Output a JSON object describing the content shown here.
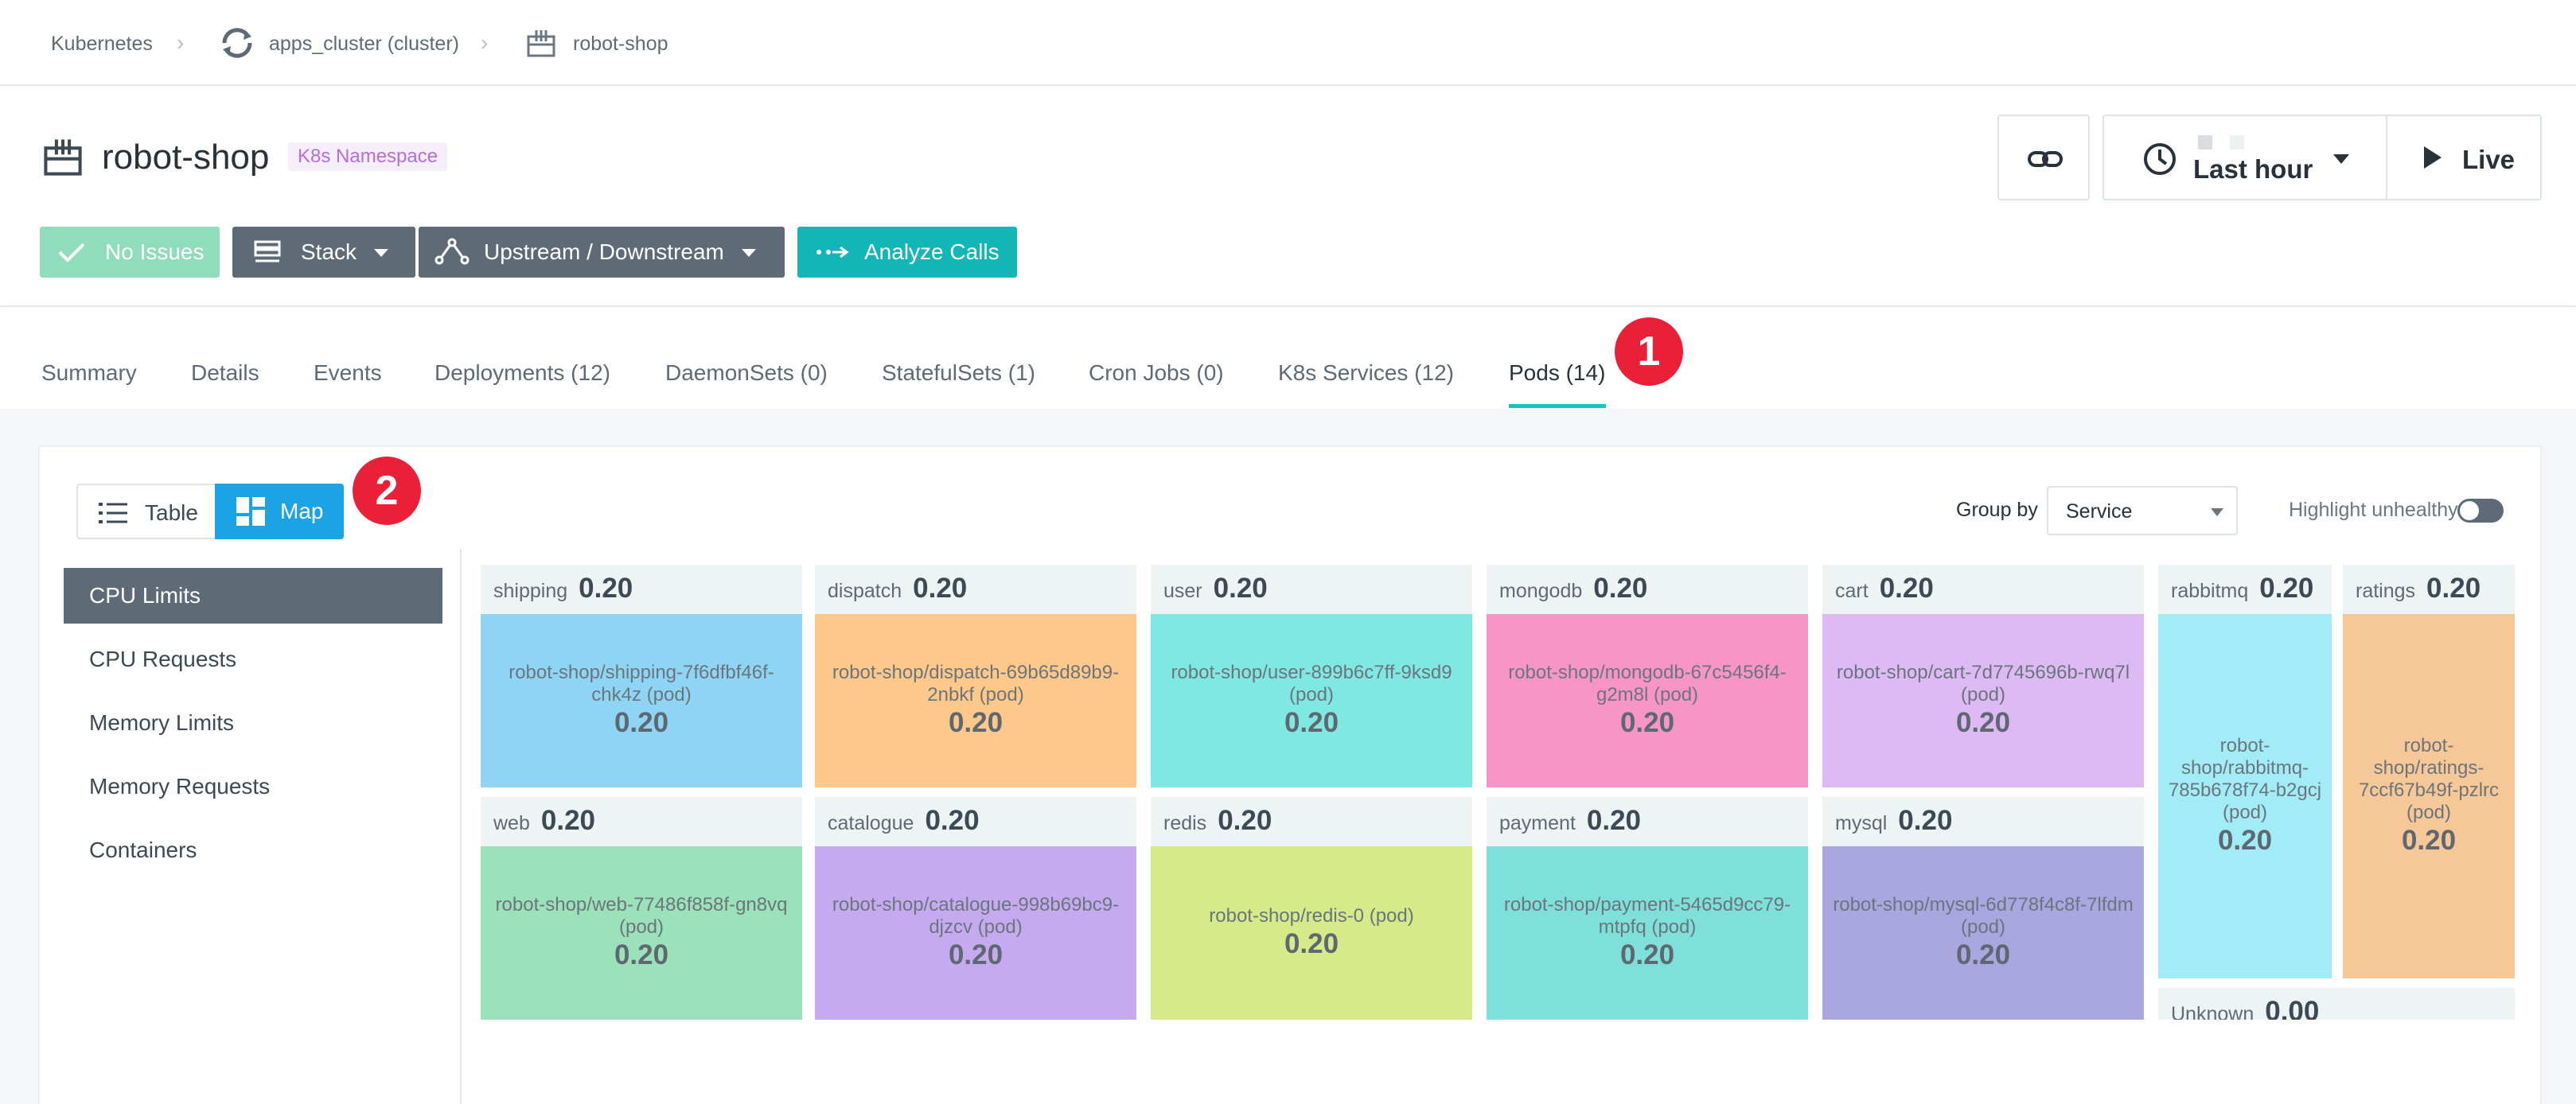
{
  "breadcrumb": {
    "root": "Kubernetes",
    "cluster": "apps_cluster (cluster)",
    "namespace": "robot-shop"
  },
  "header": {
    "title": "robot-shop",
    "badge": "K8s Namespace",
    "time_range": "Last hour",
    "live_label": "Live"
  },
  "actions": {
    "no_issues": "No Issues",
    "stack": "Stack",
    "upstream": "Upstream / Downstream",
    "analyze": "Analyze Calls"
  },
  "tabs": [
    {
      "label": "Summary"
    },
    {
      "label": "Details"
    },
    {
      "label": "Events"
    },
    {
      "label": "Deployments (12)"
    },
    {
      "label": "DaemonSets (0)"
    },
    {
      "label": "StatefulSets (1)"
    },
    {
      "label": "Cron Jobs (0)"
    },
    {
      "label": "K8s Services (12)"
    },
    {
      "label": "Pods (14)"
    }
  ],
  "annotations": {
    "step1": "1",
    "step2": "2"
  },
  "view_toggle": {
    "table": "Table",
    "map": "Map",
    "selected": "Map"
  },
  "group_by": {
    "label": "Group by",
    "value": "Service"
  },
  "highlight": {
    "label": "Highlight unhealthy",
    "enabled": false
  },
  "metrics": [
    "CPU Limits",
    "CPU Requests",
    "Memory Limits",
    "Memory Requests",
    "Containers"
  ],
  "selected_metric": "CPU Limits",
  "groups": [
    {
      "name": "shipping",
      "value": "0.20",
      "pod_name": "robot-shop/shipping-7f6dfbf46f-chk4z (pod)",
      "pod_value": "0.20",
      "color": "#8ed4f5"
    },
    {
      "name": "dispatch",
      "value": "0.20",
      "pod_name": "robot-shop/dispatch-69b65d89b9-2nbkf (pod)",
      "pod_value": "0.20",
      "color": "#fdc88a"
    },
    {
      "name": "user",
      "value": "0.20",
      "pod_name": "robot-shop/user-899b6c7ff-9ksd9 (pod)",
      "pod_value": "0.20",
      "color": "#7fe8e2"
    },
    {
      "name": "mongodb",
      "value": "0.20",
      "pod_name": "robot-shop/mongodb-67c5456f4-g2m8l (pod)",
      "pod_value": "0.20",
      "color": "#f795c6"
    },
    {
      "name": "cart",
      "value": "0.20",
      "pod_name": "robot-shop/cart-7d7745696b-rwq7l (pod)",
      "pod_value": "0.20",
      "color": "#ddbaf3"
    },
    {
      "name": "rabbitmq",
      "value": "0.20",
      "pod_name": "robot-shop/rabbitmq-785b678f74-b2gcj (pod)",
      "pod_value": "0.20",
      "color": "#a2ecf7"
    },
    {
      "name": "ratings",
      "value": "0.20",
      "pod_name": "robot-shop/ratings-7ccf67b49f-pzlrc (pod)",
      "pod_value": "0.20",
      "color": "#f7c897"
    },
    {
      "name": "web",
      "value": "0.20",
      "pod_name": "robot-shop/web-77486f858f-gn8vq (pod)",
      "pod_value": "0.20",
      "color": "#9be1b9"
    },
    {
      "name": "catalogue",
      "value": "0.20",
      "pod_name": "robot-shop/catalogue-998b69bc9-djzcv (pod)",
      "pod_value": "0.20",
      "color": "#c6aaef"
    },
    {
      "name": "redis",
      "value": "0.20",
      "pod_name": "robot-shop/redis-0 (pod)",
      "pod_value": "0.20",
      "color": "#d7ea8a"
    },
    {
      "name": "payment",
      "value": "0.20",
      "pod_name": "robot-shop/payment-5465d9cc79-mtpfq (pod)",
      "pod_value": "0.20",
      "color": "#7fdfdb"
    },
    {
      "name": "mysql",
      "value": "0.20",
      "pod_name": "robot-shop/mysql-6d778f4c8f-7lfdm (pod)",
      "pod_value": "0.20",
      "color": "#a9a6e0"
    },
    {
      "name": "Unknown",
      "value": "0.00",
      "pod_name": "",
      "pod_value": "",
      "color": "#eef3f4"
    }
  ]
}
